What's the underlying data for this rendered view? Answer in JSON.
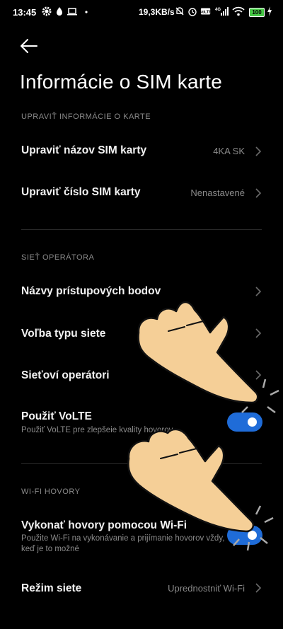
{
  "status_bar": {
    "time": "13:45",
    "speed": "19,3KB/s",
    "battery": "100",
    "icons": [
      "gear-icon",
      "water-drop-icon",
      "laptop-icon",
      "dot-icon",
      "mute-bell-icon",
      "alarm-icon",
      "volte-icon",
      "signal-4g-icon",
      "wifi-icon",
      "battery-icon",
      "charging-icon"
    ]
  },
  "header": {
    "title": "Informácie o SIM karte"
  },
  "sections": {
    "card_info": {
      "header": "UPRAVIŤ INFORMÁCIE O KARTE",
      "edit_name_label": "Upraviť názov SIM karty",
      "edit_name_value": "4KA SK",
      "edit_number_label": "Upraviť číslo SIM karty",
      "edit_number_value": "Nenastavené"
    },
    "operator": {
      "header": "SIEŤ OPERÁTORA",
      "apn_label": "Názvy prístupových bodov",
      "network_type_label": "Voľba typu siete",
      "operators_label": "Sieťoví operátori",
      "volte_label": "Použiť VoLTE",
      "volte_sub": "Použiť VoLTE pre zlepšeie kvality hovorov",
      "volte_enabled": true
    },
    "wifi_calls": {
      "header": "WI-FI HOVORY",
      "wifi_call_label": "Vykonať hovory pomocou Wi-Fi",
      "wifi_call_sub": "Použite Wi-Fi na vykonávanie a prijímanie hovorov vždy, keď je to možné",
      "wifi_call_enabled": true,
      "network_mode_label": "Režim siete",
      "network_mode_value": "Uprednostniť Wi-Fi"
    }
  },
  "colors": {
    "background": "#000000",
    "accent": "#1f6cd8",
    "secondary_text": "#8a8a8a",
    "hand_fill": "#f5cf97"
  }
}
